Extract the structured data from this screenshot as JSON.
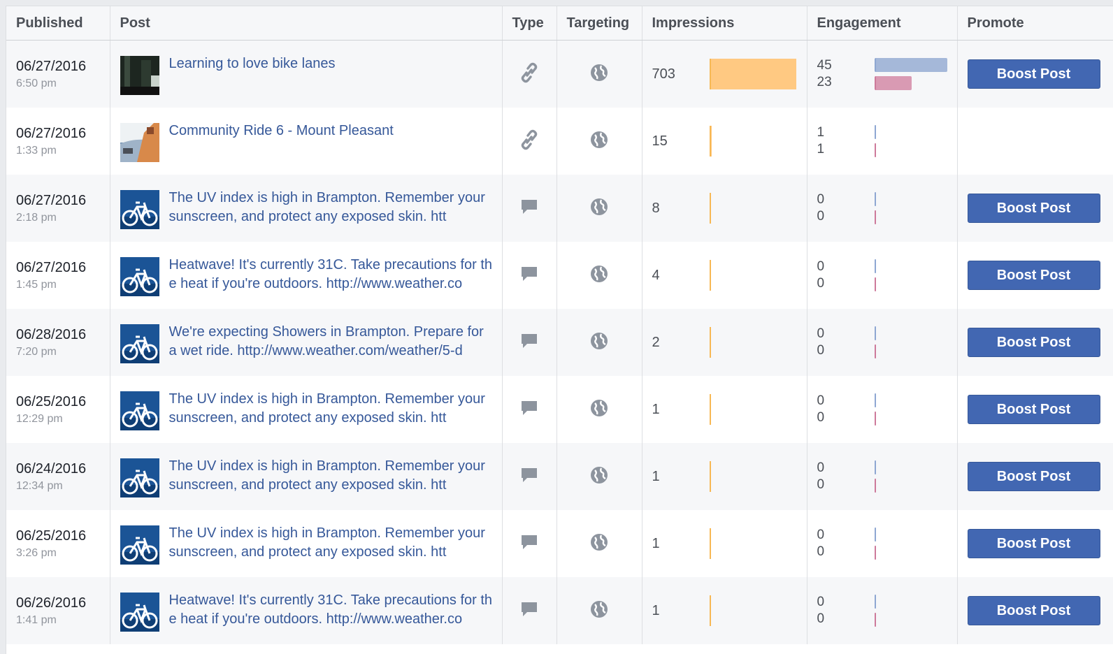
{
  "headers": {
    "published": "Published",
    "post": "Post",
    "type": "Type",
    "targeting": "Targeting",
    "impressions": "Impressions",
    "engagement": "Engagement",
    "promote": "Promote"
  },
  "max_impressions": 703,
  "max_engagement": 45,
  "colors": {
    "impressions": "#ffc982",
    "engagement_clicks": "#a5b8d9",
    "engagement_reactions": "#d99ab3",
    "boost": "#4267b2",
    "link": "#365899"
  },
  "rows": [
    {
      "date": "06/27/2016",
      "time": "6:50 pm",
      "text": "Learning to love bike lanes",
      "thumb": "photo-dark",
      "type_icon": "link-icon",
      "impressions": 703,
      "eng1": 45,
      "eng2": 23,
      "boost_label": "Boost Post",
      "show_boost": true
    },
    {
      "date": "06/27/2016",
      "time": "1:33 pm",
      "text": "Community Ride 6 - Mount Pleasant",
      "thumb": "photo-ride",
      "type_icon": "link-icon",
      "impressions": 15,
      "eng1": 1,
      "eng2": 1,
      "boost_label": "",
      "show_boost": false
    },
    {
      "date": "06/27/2016",
      "time": "2:18 pm",
      "text": "The UV index is high in Brampton. Remember your sunscreen, and protect any exposed skin. htt",
      "thumb": "bike-logo",
      "type_icon": "status-icon",
      "impressions": 8,
      "eng1": 0,
      "eng2": 0,
      "boost_label": "Boost Post",
      "show_boost": true
    },
    {
      "date": "06/27/2016",
      "time": "1:45 pm",
      "text": "Heatwave! It's currently 31C. Take precautions for the heat if you're outdoors. http://www.weather.co",
      "thumb": "bike-logo",
      "type_icon": "status-icon",
      "impressions": 4,
      "eng1": 0,
      "eng2": 0,
      "boost_label": "Boost Post",
      "show_boost": true
    },
    {
      "date": "06/28/2016",
      "time": "7:20 pm",
      "text": "We're expecting Showers in Brampton. Prepare for a wet ride. http://www.weather.com/weather/5-d",
      "thumb": "bike-logo",
      "type_icon": "status-icon",
      "impressions": 2,
      "eng1": 0,
      "eng2": 0,
      "boost_label": "Boost Post",
      "show_boost": true
    },
    {
      "date": "06/25/2016",
      "time": "12:29 pm",
      "text": "The UV index is high in Brampton. Remember your sunscreen, and protect any exposed skin. htt",
      "thumb": "bike-logo",
      "type_icon": "status-icon",
      "impressions": 1,
      "eng1": 0,
      "eng2": 0,
      "boost_label": "Boost Post",
      "show_boost": true
    },
    {
      "date": "06/24/2016",
      "time": "12:34 pm",
      "text": "The UV index is high in Brampton. Remember your sunscreen, and protect any exposed skin. htt",
      "thumb": "bike-logo",
      "type_icon": "status-icon",
      "impressions": 1,
      "eng1": 0,
      "eng2": 0,
      "boost_label": "Boost Post",
      "show_boost": true
    },
    {
      "date": "06/25/2016",
      "time": "3:26 pm",
      "text": "The UV index is high in Brampton. Remember your sunscreen, and protect any exposed skin. htt",
      "thumb": "bike-logo",
      "type_icon": "status-icon",
      "impressions": 1,
      "eng1": 0,
      "eng2": 0,
      "boost_label": "Boost Post",
      "show_boost": true
    },
    {
      "date": "06/26/2016",
      "time": "1:41 pm",
      "text": "Heatwave! It's currently 31C. Take precautions for the heat if you're outdoors. http://www.weather.co",
      "thumb": "bike-logo",
      "type_icon": "status-icon",
      "impressions": 1,
      "eng1": 0,
      "eng2": 0,
      "boost_label": "Boost Post",
      "show_boost": true
    }
  ]
}
